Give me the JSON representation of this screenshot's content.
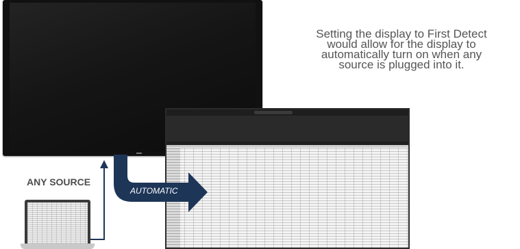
{
  "description": "Setting the display to First Detect\nwould allow for the display to\nautomatically turn on when any\nsource is plugged into it.",
  "labels": {
    "any_source": "ANY SOURCE",
    "automatic": "AUTOMATIC"
  },
  "colors": {
    "navy_arrow": "#1d3557",
    "display_bezel": "#111111",
    "text_gray": "#555555"
  }
}
